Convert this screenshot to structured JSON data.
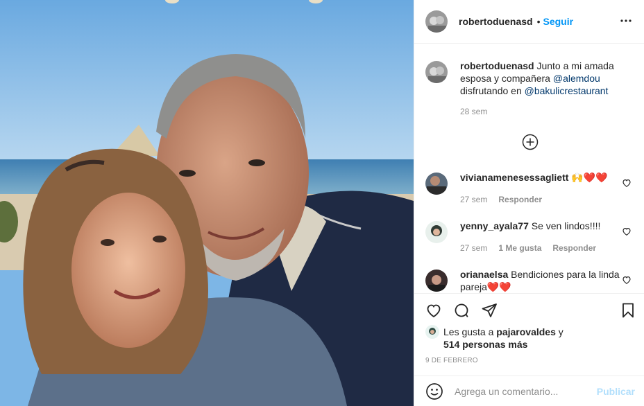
{
  "post": {
    "author": "robertoduenasd",
    "follow_label": "Seguir",
    "dot": "•",
    "more_icon": "more-horizontal-icon"
  },
  "caption": {
    "username": "robertoduenasd",
    "text_before": " Junto a mi amada esposa y compañera ",
    "mention_1": "@alemdou",
    "text_middle": " disfrutando en ",
    "mention_2": "@bakulicrestaurant",
    "time": "28 sem"
  },
  "comments": [
    {
      "username": "vivianamenesessagliett",
      "text": " 🙌❤️❤️",
      "time": "27 sem",
      "likes": "",
      "reply": "Responder"
    },
    {
      "username": "yenny_ayala77",
      "text": " Se ven lindos!!!!",
      "time": "27 sem",
      "likes": "1 Me gusta",
      "reply": "Responder"
    },
    {
      "username": "orianaelsa",
      "text": " Bendiciones para la linda pareja❤️❤️",
      "time": "",
      "likes": "",
      "reply": ""
    }
  ],
  "likes": {
    "prefix": "Les gusta a ",
    "user": "pajarovaldes",
    "middle": " y ",
    "count": "514 personas más"
  },
  "date": "9 DE FEBRERO",
  "add_comment": {
    "placeholder": "Agrega un comentario...",
    "publish": "Publicar"
  },
  "colors": {
    "link": "#00376b",
    "follow": "#0095f6",
    "publish_disabled": "#b2dffc",
    "meta": "#8e8e8e"
  }
}
